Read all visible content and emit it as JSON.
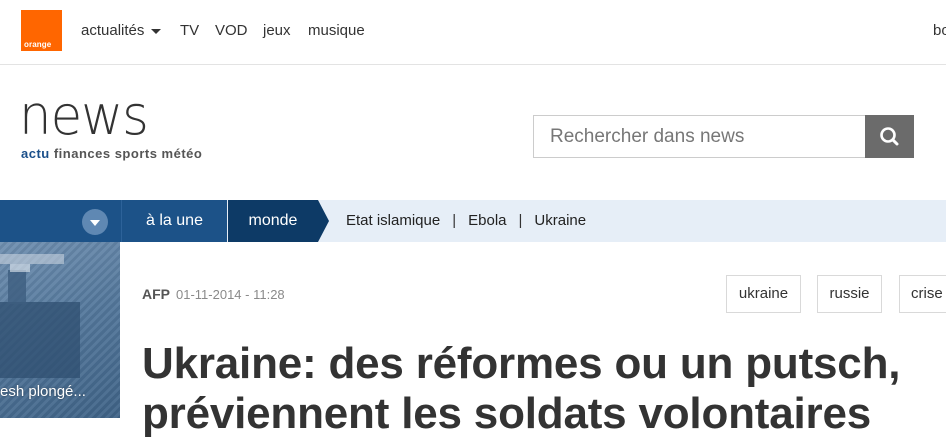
{
  "topbar": {
    "logo_text": "orange",
    "nav": [
      {
        "label": "actualités",
        "has_caret": true
      },
      {
        "label": "TV"
      },
      {
        "label": "VOD"
      },
      {
        "label": "jeux"
      },
      {
        "label": "musique"
      }
    ],
    "right_partial": "bo"
  },
  "header": {
    "brand": "news",
    "subnav": {
      "accent": "actu",
      "rest": " finances sports météo"
    },
    "search": {
      "placeholder": "Rechercher dans news",
      "icon": "search-icon"
    }
  },
  "section_nav": {
    "tabs": [
      {
        "label": "à la une",
        "active": false
      },
      {
        "label": "monde",
        "active": true
      }
    ],
    "links": [
      "Etat islamique",
      "Ebola",
      "Ukraine"
    ],
    "colors": {
      "primary": "#1c5288",
      "active": "#0d3a66",
      "bar": "#e6eef7"
    }
  },
  "side_teaser": {
    "caption": "esh plongé..."
  },
  "article": {
    "source": "AFP",
    "date": "01-11-2014 - 11:28",
    "tags": [
      "ukraine",
      "russie",
      "crise"
    ],
    "headline_line1": "Ukraine: des réformes ou un putsch,",
    "headline_line2": "préviennent les soldats volontaires"
  }
}
